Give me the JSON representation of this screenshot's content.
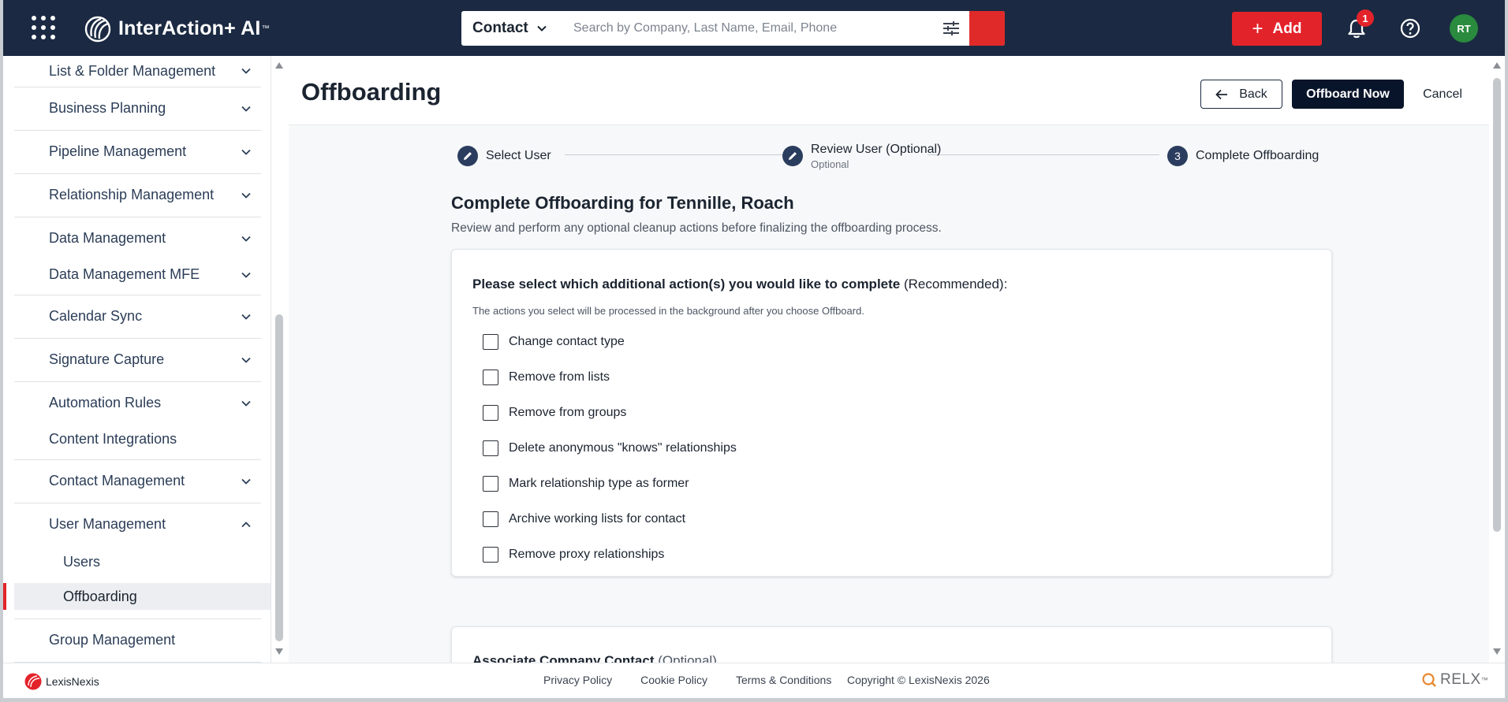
{
  "header": {
    "brand": "InterAction+ AI",
    "brand_tm": "™",
    "search_type": "Contact",
    "search_placeholder": "Search by Company, Last Name, Email, Phone",
    "add_label": "Add",
    "notification_count": "1",
    "avatar_initials": "RT",
    "colors": {
      "topbar": "#1b2a42",
      "accent": "#e3232a",
      "avatar": "#2a8a3e"
    }
  },
  "sidebar": {
    "items": [
      {
        "label": "List & Folder Management",
        "chevron": "down"
      },
      {
        "label": "Business Planning",
        "chevron": "down"
      },
      {
        "label": "Pipeline Management",
        "chevron": "down"
      },
      {
        "label": "Relationship Management",
        "chevron": "down"
      },
      {
        "label": "Data Management",
        "chevron": "down"
      },
      {
        "label": "Data Management MFE",
        "chevron": "down"
      },
      {
        "label": "Calendar Sync",
        "chevron": "down"
      },
      {
        "label": "Signature Capture",
        "chevron": "down"
      },
      {
        "label": "Automation Rules",
        "chevron": "down"
      },
      {
        "label": "Content Integrations",
        "chevron": "none"
      },
      {
        "label": "Contact Management",
        "chevron": "down"
      },
      {
        "label": "User Management",
        "chevron": "up"
      },
      {
        "label": "Group Management",
        "chevron": "none"
      }
    ],
    "subitems": [
      {
        "label": "Users",
        "active": false
      },
      {
        "label": "Offboarding",
        "active": true
      }
    ]
  },
  "page": {
    "title": "Offboarding",
    "back_label": "Back",
    "offboard_label": "Offboard Now",
    "cancel_label": "Cancel"
  },
  "stepper": {
    "steps": [
      {
        "label": "Select User",
        "sub": "",
        "icon": "pencil-icon"
      },
      {
        "label": "Review User (Optional)",
        "sub": "Optional",
        "icon": "pencil-icon"
      },
      {
        "label": "Complete Offboarding",
        "sub": "",
        "number": "3"
      }
    ]
  },
  "section": {
    "title": "Complete Offboarding for Tennille, Roach",
    "description": "Review and perform any optional cleanup actions before finalizing the offboarding process."
  },
  "actions_card": {
    "question": "Please select which additional action(s) you would like to complete",
    "question_suffix": "(Recommended):",
    "note": "The actions you select will be processed in the background after you choose Offboard.",
    "options": [
      {
        "label": "Change contact type",
        "checked": false
      },
      {
        "label": "Remove from lists",
        "checked": false
      },
      {
        "label": "Remove from groups",
        "checked": false
      },
      {
        "label": "Delete anonymous \"knows\" relationships",
        "checked": false
      },
      {
        "label": "Mark relationship type as former",
        "checked": false
      },
      {
        "label": "Archive working lists for contact",
        "checked": false
      },
      {
        "label": "Remove proxy relationships",
        "checked": false
      }
    ]
  },
  "associate_card": {
    "title": "Associate Company Contact",
    "title_suffix": "(Optional)"
  },
  "footer": {
    "logo_text": "LexisNexis",
    "links": [
      "Privacy Policy",
      "Cookie Policy",
      "Terms & Conditions"
    ],
    "copyright": "Copyright © LexisNexis 2026",
    "relx": "RELX",
    "relx_tm": "™"
  }
}
